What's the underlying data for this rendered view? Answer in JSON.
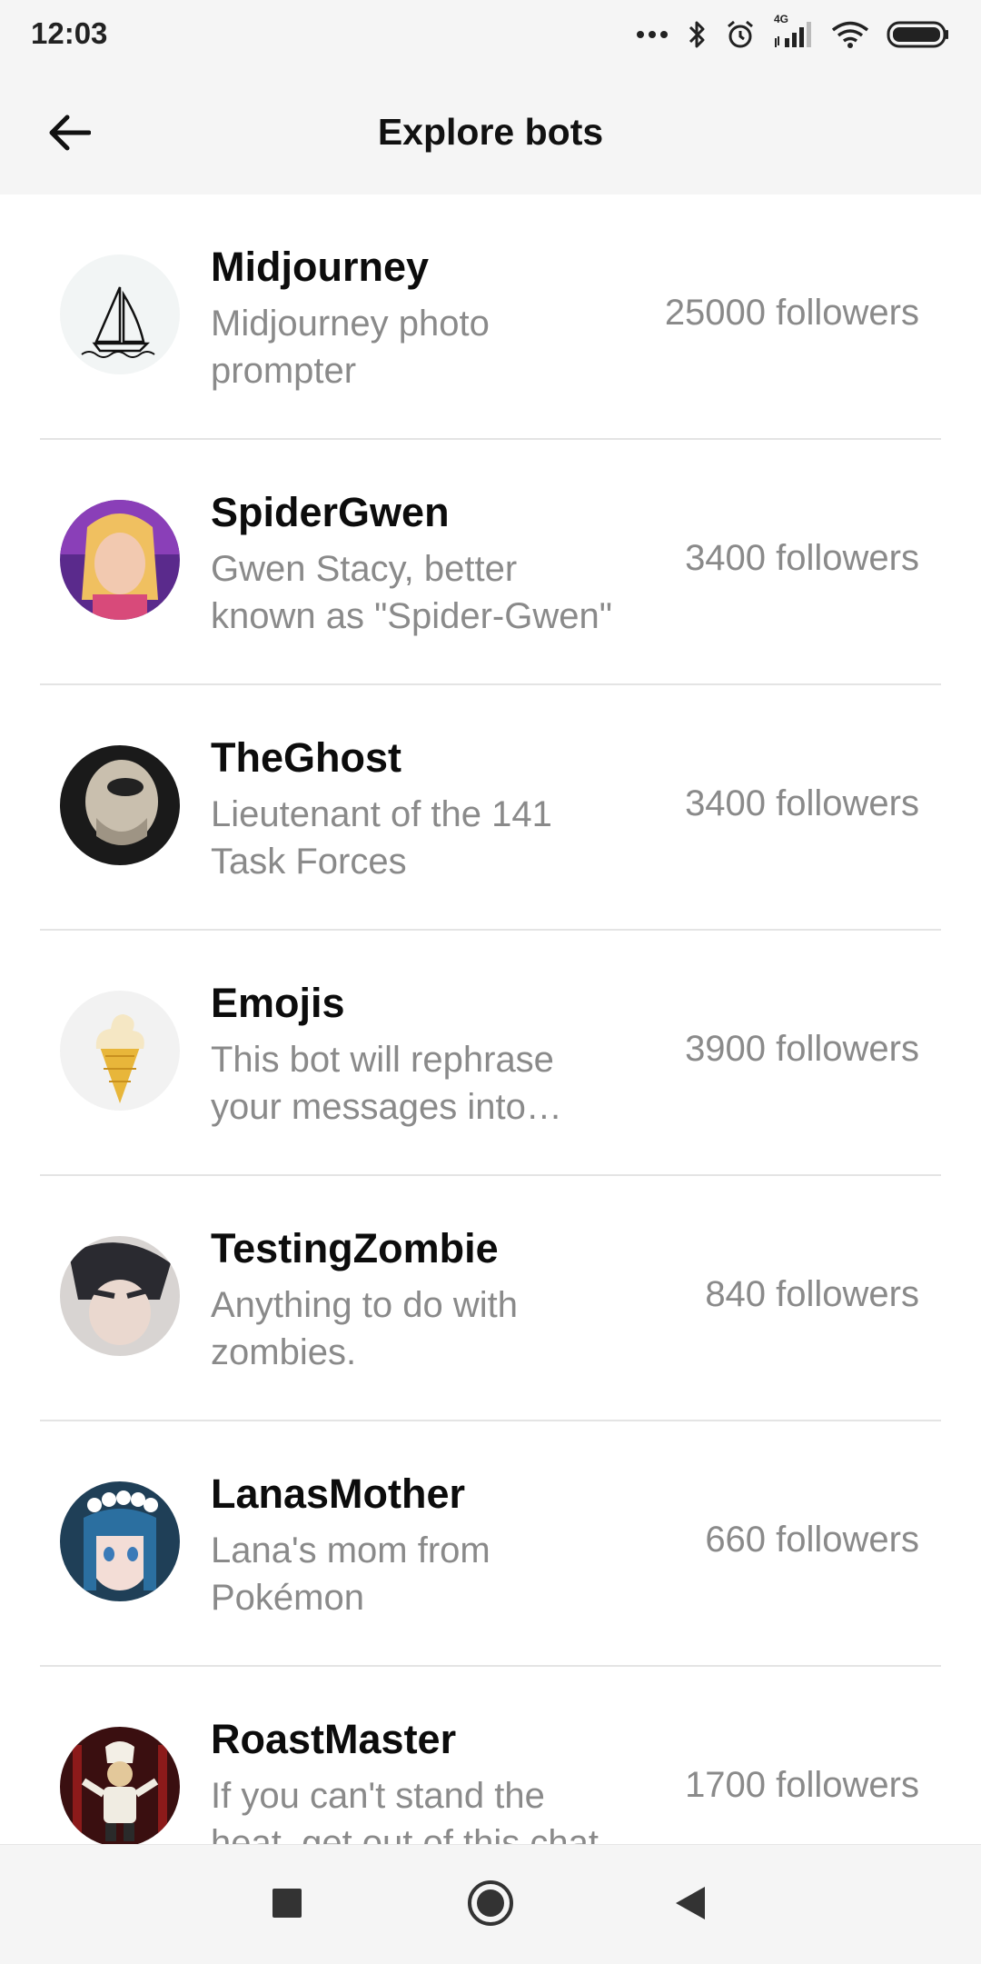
{
  "status_bar": {
    "time": "12:03",
    "network": "4G",
    "icons": [
      "more-dots-icon",
      "bluetooth-icon",
      "alarm-icon",
      "signal-icon",
      "wifi-icon",
      "battery-icon"
    ]
  },
  "header": {
    "title": "Explore bots",
    "back_icon": "arrow-left-icon"
  },
  "bots": [
    {
      "name": "Midjourney",
      "description": "Midjourney photo prompter",
      "followers": "25000 followers",
      "avatar": "sailboat-logo"
    },
    {
      "name": "SpiderGwen",
      "description": "Gwen Stacy, better known as \"Spider-Gwen\"",
      "followers": "3400 followers",
      "avatar": "character-portrait"
    },
    {
      "name": "TheGhost",
      "description": "Lieutenant of the 141 Task Forces",
      "followers": "3400 followers",
      "avatar": "skull-mask"
    },
    {
      "name": "Emojis",
      "description": "This bot will rephrase your messages into emojis",
      "followers": "3900 followers",
      "avatar": "ice-cream-emoji"
    },
    {
      "name": "TestingZombie",
      "description": "Anything to do with zombies.",
      "followers": "840 followers",
      "avatar": "anime-character"
    },
    {
      "name": "LanasMother",
      "description": "Lana's mom from Pokémon",
      "followers": "660 followers",
      "avatar": "anime-character"
    },
    {
      "name": "RoastMaster",
      "description": "If you can't stand the heat, get out of this chat",
      "followers": "1700 followers",
      "avatar": "chef-figure"
    }
  ],
  "nav_bar": {
    "icons": [
      "square-recents-icon",
      "circle-home-icon",
      "triangle-back-icon"
    ]
  },
  "colors": {
    "bar_background": "#f5f5f5",
    "name_text": "#0c0c0c",
    "secondary_text": "#8a8a8a",
    "divider": "#e4e4e4"
  }
}
